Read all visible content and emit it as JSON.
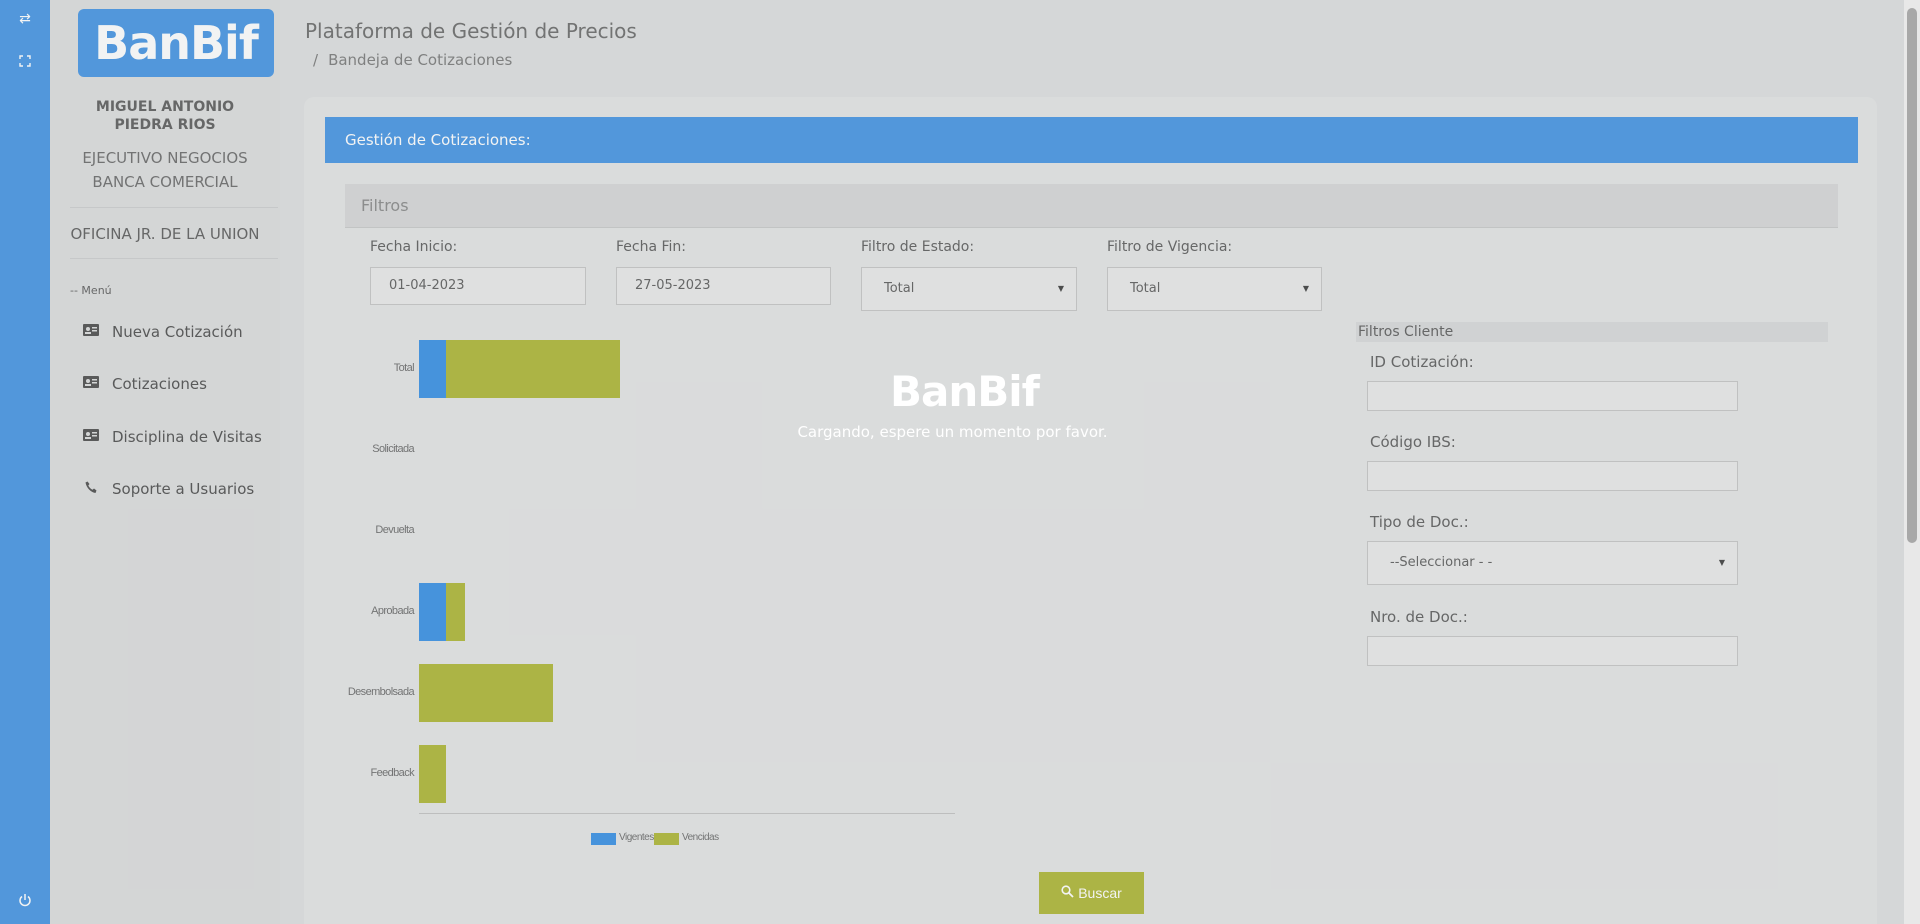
{
  "rail": {
    "icons": [
      "swap-arrows-icon",
      "fullscreen-icon",
      "power-icon"
    ]
  },
  "sidebar": {
    "logo_text": "BanBif",
    "user_name": "MIGUEL ANTONIO PIEDRA RIOS",
    "role_line1": "EJECUTIVO NEGOCIOS",
    "role_line2": "BANCA COMERCIAL",
    "office": "OFICINA JR. DE LA UNION",
    "menu_caption": "-- Menú",
    "items": [
      {
        "label": "Nueva Cotización",
        "icon": "id-card-icon"
      },
      {
        "label": "Cotizaciones",
        "icon": "id-card-icon"
      },
      {
        "label": "Disciplina de Visitas",
        "icon": "id-card-icon"
      },
      {
        "label": "Soporte a Usuarios",
        "icon": "phone-icon"
      }
    ]
  },
  "header": {
    "title": "Plataforma de Gestión de Precios",
    "breadcrumb_sep": "/",
    "breadcrumb": "Bandeja de Cotizaciones"
  },
  "card": {
    "title": "Gestión de Cotizaciones:",
    "filters_title": "Filtros"
  },
  "filters": {
    "fecha_inicio_label": "Fecha Inicio:",
    "fecha_inicio_value": "01-04-2023",
    "fecha_fin_label": "Fecha Fin:",
    "fecha_fin_value": "27-05-2023",
    "estado_label": "Filtro de Estado:",
    "estado_value": "Total",
    "vigencia_label": "Filtro de Vigencia:",
    "vigencia_value": "Total"
  },
  "client_filters": {
    "title": "Filtros Cliente",
    "id_label": "ID Cotización:",
    "id_value": "",
    "ibs_label": "Código IBS:",
    "ibs_value": "",
    "tipo_label": "Tipo de Doc.:",
    "tipo_value": "--Seleccionar - -",
    "nro_label": "Nro. de Doc.:",
    "nro_value": ""
  },
  "chart_data": {
    "type": "bar",
    "orientation": "horizontal",
    "stacked": true,
    "categories": [
      "Total",
      "Solicitada",
      "Devuelta",
      "Aprobada",
      "Desembolsada",
      "Feedback"
    ],
    "series": [
      {
        "name": "Vigentes",
        "color": "#1a7fe0",
        "values": [
          2,
          0,
          0,
          2,
          0,
          0
        ]
      },
      {
        "name": "Vencidas",
        "color": "#a2ab17",
        "values": [
          13,
          0,
          0,
          1.4,
          10,
          2
        ]
      }
    ],
    "xlim": [
      0,
      40
    ],
    "grid": false,
    "legend": "bottom"
  },
  "loading": {
    "logo_text": "BanBif",
    "message": "Cargando, espere un momento por favor."
  },
  "search_button": "Buscar",
  "colors": {
    "primary": "#2a85df",
    "accent": "#a2ab17"
  }
}
